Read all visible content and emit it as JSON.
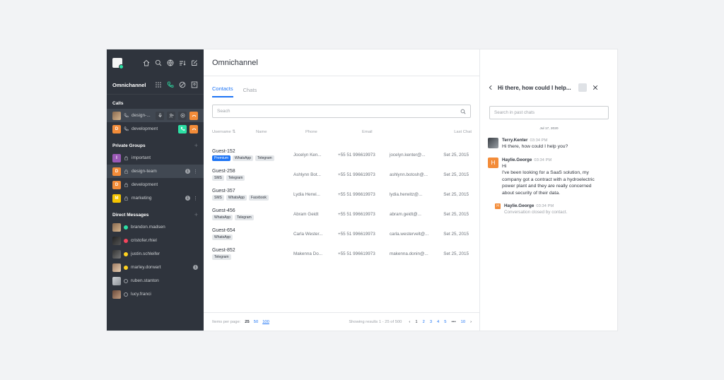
{
  "sidebar": {
    "title": "Omnichannel",
    "calls_header": "Calls",
    "calls": [
      {
        "label": "design-...",
        "avatar": "photo",
        "active": true
      },
      {
        "label": "development",
        "avatar": "D",
        "color": "#f38c39"
      }
    ],
    "private_header": "Private Groups",
    "private": [
      {
        "label": "important",
        "avatar": "I",
        "color": "#9b59b6"
      },
      {
        "label": "design-team",
        "avatar": "D",
        "color": "#f38c39",
        "badge": "1",
        "active": true
      },
      {
        "label": "development",
        "avatar": "D",
        "color": "#f38c39"
      },
      {
        "label": "marketing",
        "avatar": "M",
        "color": "#f5c400",
        "badge": "1"
      }
    ],
    "dm_header": "Direct Messages",
    "dms": [
      {
        "label": "brandon.madsen",
        "status": "#2de0a5"
      },
      {
        "label": "cristofer.rhiel",
        "status": "#f5455c"
      },
      {
        "label": "justin.schleifer",
        "status": "#ffd21f"
      },
      {
        "label": "marley.dorwart",
        "status": "#ffd21f",
        "badge": "1"
      },
      {
        "label": "ruben.stanton",
        "status": "none"
      },
      {
        "label": "lucy.franci",
        "status": "none"
      }
    ]
  },
  "main": {
    "title": "Omnichannel",
    "tabs": [
      "Contacts",
      "Chats"
    ],
    "search_placeholder": "Seach",
    "columns": [
      "Username",
      "Name",
      "Phone",
      "Email",
      "Last Chat"
    ],
    "rows": [
      {
        "user": "Guest-152",
        "tags": [
          "Premium",
          "WhatsApp",
          "Telegram"
        ],
        "name": "Jocelyn Ken...",
        "phone": "+55 51 996619973",
        "email": "jocelyn.kenter@...",
        "last": "Set 25, 2015"
      },
      {
        "user": "Guest-258",
        "tags": [
          "SMS",
          "Telegram"
        ],
        "name": "Ashlynn Bot...",
        "phone": "+55 51 996619973",
        "email": "ashlynn.botosh@...",
        "last": "Set 25, 2015"
      },
      {
        "user": "Guest-357",
        "tags": [
          "SMS",
          "WhatsApp",
          "Facebook"
        ],
        "name": "Lydia Herwi...",
        "phone": "+55 51 996619973",
        "email": "lydia.herwitz@...",
        "last": "Set 25, 2015"
      },
      {
        "user": "Guest-456",
        "tags": [
          "WhatsApp",
          "Telegram"
        ],
        "name": "Abram Geidt",
        "phone": "+55 51 996619973",
        "email": "abram.geidt@...",
        "last": "Set 25, 2015"
      },
      {
        "user": "Guest-654",
        "tags": [
          "WhatsApp"
        ],
        "name": "Carla Wester...",
        "phone": "+55 51 996619973",
        "email": "carla.westervelt@...",
        "last": "Set 25, 2015"
      },
      {
        "user": "Guest-852",
        "tags": [
          "Telegram"
        ],
        "name": "Makenna Do...",
        "phone": "+55 51 996619973",
        "email": "makenna.donin@...",
        "last": "Set 25, 2015"
      }
    ],
    "pager": {
      "label": "Items per page:",
      "sizes": [
        "25",
        "50",
        "100"
      ],
      "results": "Showing results 1 - 25 of 500",
      "pages": [
        "1",
        "2",
        "3",
        "4",
        "5",
        "•••",
        "10"
      ]
    }
  },
  "panel": {
    "title": "Hi there, how could I help...",
    "search_placeholder": "Search in past chats",
    "date": "Jul 17, 2020",
    "messages": [
      {
        "user": "Terry.Kenter",
        "time": "03:34 PM",
        "text": "Hi there, how could I help you?"
      },
      {
        "user": "Haylie.George",
        "time": "03:34 PM",
        "text": "Hi\nI've been looking for a SaaS solution, my company got a contract with a hydroelectric power plant and they are really concerned about security of their data."
      }
    ],
    "system": {
      "user": "Haylie.George",
      "time": "03:34 PM",
      "text": "Conversation closed by contact."
    }
  }
}
